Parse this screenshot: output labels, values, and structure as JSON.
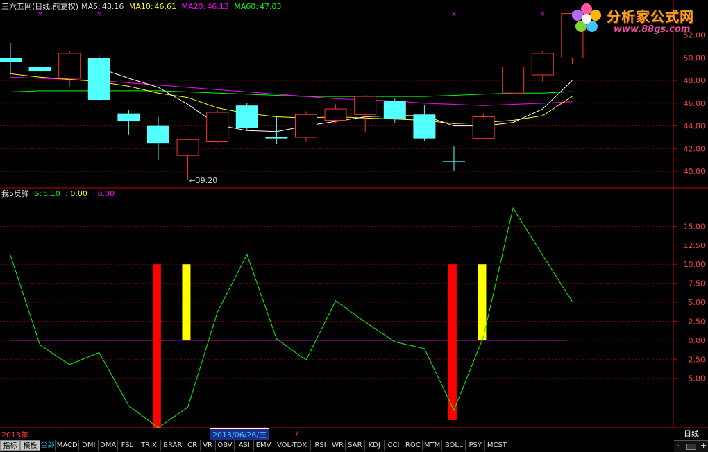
{
  "header": {
    "title": "三六五网(日线,前复权)",
    "ma5_label": "MA5:",
    "ma5": "48.16",
    "ma10_label": "MA10:",
    "ma10": "46.61",
    "ma20_label": "MA20:",
    "ma20": "46.13",
    "ma60_label": "MA60:",
    "ma60": "47.03"
  },
  "logo": {
    "brand": "分析家公式网",
    "site": "www.88gs.com"
  },
  "price_axis": {
    "ticks": [
      "52.00",
      "50.00",
      "48.00",
      "46.00",
      "44.00",
      "42.00",
      "40.00"
    ]
  },
  "min_annotation": "←39.20",
  "indicator_header": {
    "name": "我5反弹",
    "s_label": "S:",
    "s_value": "5.10",
    "v2": ": 0.00",
    "v3": ": 0.00"
  },
  "indicator_axis": {
    "ticks": [
      "15.00",
      "12.50",
      "10.00",
      "7.50",
      "5.00",
      "2.50",
      "0.00",
      "-2.50",
      "-5.00"
    ]
  },
  "date_bar": {
    "year": "2013年",
    "current_date": "2013/06/26/三",
    "marker": "7"
  },
  "period": "日线",
  "tabs": [
    "全部",
    "MACD",
    "DMI",
    "DMA",
    "FSL",
    "TRIX",
    "BRAR",
    "CR",
    "VR",
    "OBV",
    "ASI",
    "EMV",
    "VOL-TDX",
    "RSI",
    "WR",
    "SAR",
    "KDJ",
    "CCI",
    "ROC",
    "MTM",
    "BOLL",
    "PSY",
    "MCST"
  ],
  "side_tabs": [
    "指标",
    "模板"
  ],
  "scroll": {
    "minus": "-",
    "plus": "+"
  },
  "colors": {
    "up": "#ff3232",
    "down": "#54ffff",
    "ma5": "#ffffff",
    "ma10": "#ffff00",
    "ma20": "#ff00ff",
    "ma60": "#00ff00",
    "grid": "#7a0000"
  },
  "chart_data": [
    {
      "type": "candlestick",
      "title": "三六五网(日线,前复权)",
      "ylim": [
        38.6,
        54.0
      ],
      "candles": [
        {
          "o": 50.0,
          "c": 49.6,
          "h": 51.3,
          "l": 48.6
        },
        {
          "o": 49.2,
          "c": 48.8,
          "h": 49.4,
          "l": 48.2
        },
        {
          "o": 48.2,
          "c": 50.4,
          "h": 50.6,
          "l": 47.4
        },
        {
          "o": 50.0,
          "c": 46.3,
          "h": 50.2,
          "l": 46.2
        },
        {
          "o": 45.1,
          "c": 44.4,
          "h": 45.4,
          "l": 43.2
        },
        {
          "o": 44.0,
          "c": 42.5,
          "h": 44.8,
          "l": 41.0
        },
        {
          "o": 41.4,
          "c": 42.8,
          "h": 42.9,
          "l": 39.2
        },
        {
          "o": 42.6,
          "c": 45.2,
          "h": 45.4,
          "l": 42.5
        },
        {
          "o": 45.8,
          "c": 43.8,
          "h": 46.0,
          "l": 43.6
        },
        {
          "o": 43.0,
          "c": 42.9,
          "h": 44.9,
          "l": 42.4
        },
        {
          "o": 43.0,
          "c": 45.0,
          "h": 45.3,
          "l": 42.6
        },
        {
          "o": 44.5,
          "c": 45.5,
          "h": 45.9,
          "l": 44.2
        },
        {
          "o": 45.0,
          "c": 46.6,
          "h": 46.7,
          "l": 43.5
        },
        {
          "o": 46.2,
          "c": 44.6,
          "h": 46.4,
          "l": 44.3
        },
        {
          "o": 45.0,
          "c": 42.9,
          "h": 45.8,
          "l": 42.7
        },
        {
          "o": 40.9,
          "c": 40.8,
          "h": 42.2,
          "l": 40.0
        },
        {
          "o": 42.9,
          "c": 44.8,
          "h": 45.1,
          "l": 42.8
        },
        {
          "o": 46.9,
          "c": 49.2,
          "h": 49.2,
          "l": 46.9
        },
        {
          "o": 48.5,
          "c": 50.4,
          "h": 50.6,
          "l": 47.9
        },
        {
          "o": 50.0,
          "c": 53.9,
          "h": 54.0,
          "l": 49.4
        }
      ],
      "ma5": [
        null,
        null,
        null,
        49.1,
        48.2,
        47.4,
        45.9,
        44.1,
        43.6,
        43.5,
        44.0,
        44.4,
        44.8,
        44.9,
        44.9,
        44.0,
        44.0,
        44.3,
        45.5,
        48.0
      ],
      "ma10": [
        48.6,
        48.3,
        48.1,
        47.9,
        47.5,
        46.9,
        46.5,
        45.6,
        45.1,
        44.8,
        44.7,
        44.8,
        44.7,
        44.6,
        44.5,
        44.2,
        44.3,
        44.5,
        44.9,
        46.61
      ],
      "ma20": [
        48.3,
        48.2,
        48.1,
        48.0,
        47.8,
        47.6,
        47.4,
        47.2,
        47.0,
        46.8,
        46.6,
        46.4,
        46.3,
        46.2,
        46.0,
        45.9,
        45.8,
        45.9,
        46.0,
        46.13
      ],
      "ma60": [
        47.0,
        47.1,
        47.1,
        47.1,
        47.1,
        47.1,
        47.0,
        46.9,
        46.8,
        46.7,
        46.6,
        46.6,
        46.6,
        46.6,
        46.6,
        46.7,
        46.8,
        46.9,
        46.9,
        47.03
      ],
      "signals": [
        1,
        3,
        15,
        18
      ]
    },
    {
      "type": "line",
      "title": "我5反弹",
      "ylim": [
        -11.5,
        18.5
      ],
      "S": [
        11.2,
        -0.6,
        -3.2,
        -1.6,
        -8.6,
        -11.5,
        -8.8,
        3.7,
        11.3,
        0.2,
        -2.6,
        5.2,
        2.4,
        -0.2,
        -1.1,
        -9.2,
        0.5,
        17.4,
        11.2,
        5.1
      ],
      "bars": [
        {
          "index": 4.95,
          "color": "red",
          "from": -11.6,
          "to": 10.0
        },
        {
          "index": 5.95,
          "color": "yellow",
          "from": 0.0,
          "to": 10.0
        },
        {
          "index": 14.95,
          "color": "red",
          "from": -10.5,
          "to": 10.0
        },
        {
          "index": 15.95,
          "color": "yellow",
          "from": 0.0,
          "to": 10.0
        }
      ]
    }
  ]
}
